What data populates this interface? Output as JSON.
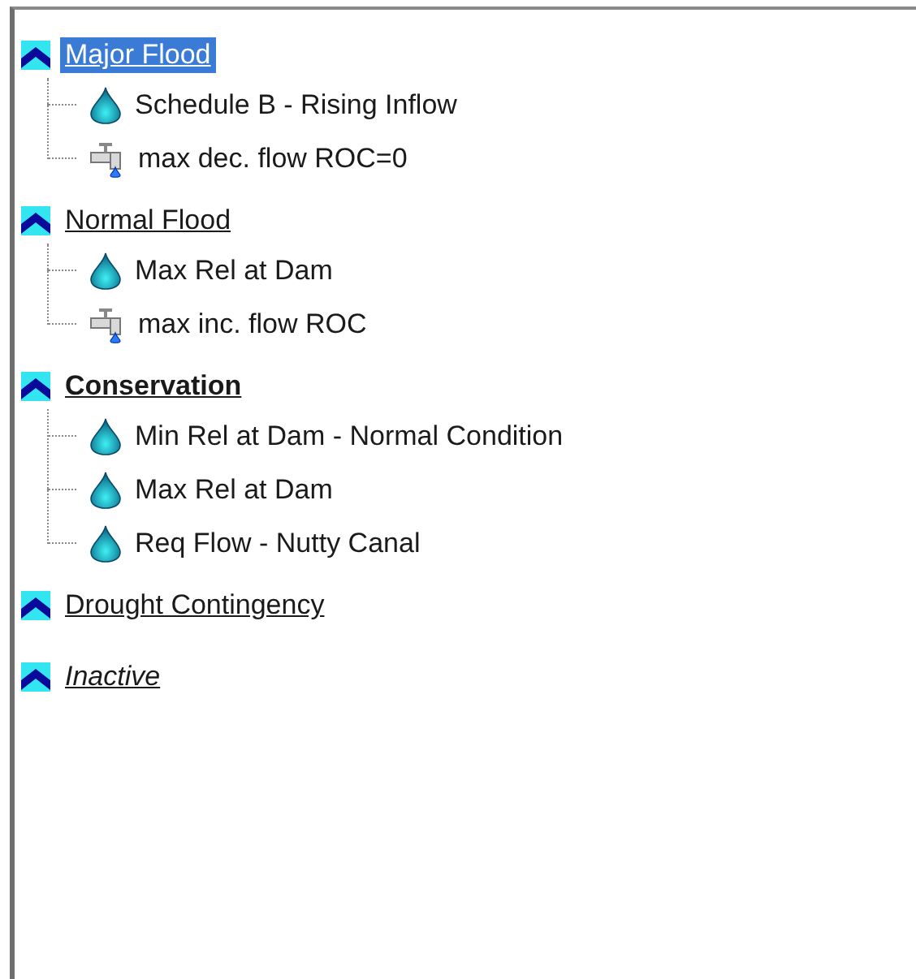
{
  "zones": [
    {
      "label": "Major Flood",
      "selected": true,
      "bold": false,
      "italic": false,
      "children": [
        {
          "label": "Schedule B - Rising Inflow",
          "kind": "rule"
        },
        {
          "label": "max dec. flow ROC=0",
          "kind": "rate"
        }
      ]
    },
    {
      "label": "Normal Flood",
      "selected": false,
      "bold": false,
      "italic": false,
      "children": [
        {
          "label": "Max Rel at Dam",
          "kind": "rule"
        },
        {
          "label": "max inc. flow ROC",
          "kind": "rate"
        }
      ]
    },
    {
      "label": "Conservation",
      "selected": false,
      "bold": true,
      "italic": false,
      "children": [
        {
          "label": "Min Rel at Dam - Normal Condition",
          "kind": "rule"
        },
        {
          "label": "Max Rel at Dam",
          "kind": "rule"
        },
        {
          "label": "Req Flow - Nutty Canal",
          "kind": "rule"
        }
      ]
    },
    {
      "label": "Drought Contingency",
      "selected": false,
      "bold": false,
      "italic": false
    },
    {
      "label": "Inactive",
      "selected": false,
      "bold": false,
      "italic": true
    }
  ]
}
